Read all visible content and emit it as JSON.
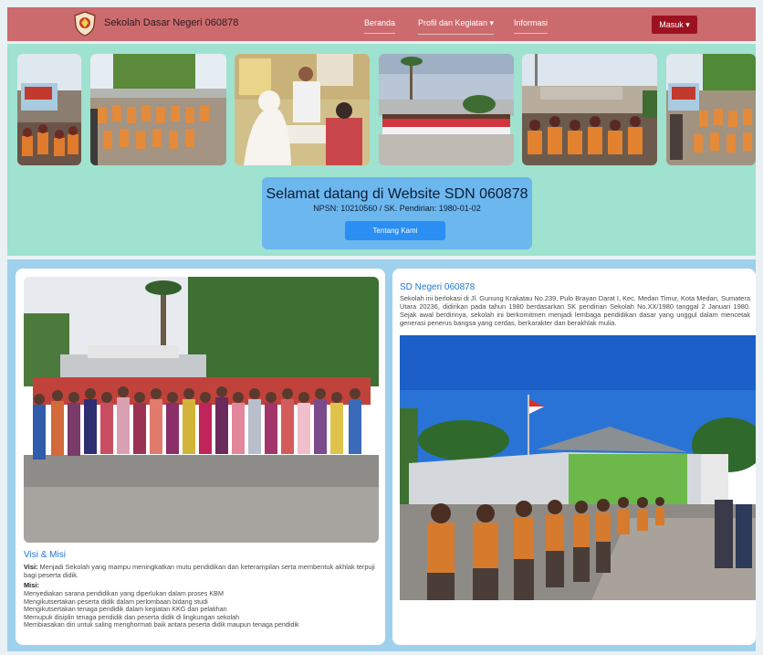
{
  "navbar": {
    "brand": "Sekolah Dasar Negeri 060878",
    "links": [
      "Beranda",
      "Profil dan Kegiatan ▾",
      "Informasi"
    ],
    "login_label": "Masuk ▾"
  },
  "hero": {
    "title": "Selamat datang di Website SDN 060878",
    "subtitle": "NPSN: 10210560 / SK. Pendirian: 1980-01-02",
    "button_label": "Tentang Kami"
  },
  "visi_misi": {
    "title": "Visi & Misi",
    "visi_label": "Visi:",
    "visi_text": "Menjadi Sekolah yang mampu meningkatkan mutu pendidikan dan keterampilan serta membentuk akhlak terpuji bagi peserta didik.",
    "misi_label": "Misi:",
    "misi_items": [
      "Menyediakan sarana pendidikan yang diperlukan dalam proses KBM",
      "Mengikutsertakan peserta didik dalam perlombaan bidang studi",
      "Mengikutsertakan tenaga pendidik dalam kegiatan KKG dan pelatihan",
      "Memupuk disiplin tenaga pendidik dan peserta didik di lingkungan sekolah",
      "Membiasakan diri untuk saling menghormati baik antara peserta didik maupun tenaga pendidik"
    ]
  },
  "about": {
    "title": "SD Negeri 060878",
    "text": "Sekolah ini berlokasi di Jl. Gunung Krakatau No.239, Pulo Brayan Darat I, Kec. Medan Timur, Kota Medan, Sumatera Utara 20236, didirikan pada tahun 1980 berdasarkan SK pendirian Sekolah No.XX/1980 tanggal 2 Januari 1980. Sejak awal berdirinya, sekolah ini berkomitmen menjadi lembaga pendidikan dasar yang unggul dalam mencetak generasi penerus bangsa yang cerdas, berkarakter dan berakhlak mulia."
  },
  "colors": {
    "navbar": "#cc6b6e",
    "hero_bg": "#9fe2cf",
    "welcome_box": "#6db7ef",
    "button": "#2a8ef2",
    "login": "#9c1220",
    "title_blue": "#2176d6"
  },
  "icons": [
    "school-logo-icon",
    "caret-down-icon"
  ]
}
